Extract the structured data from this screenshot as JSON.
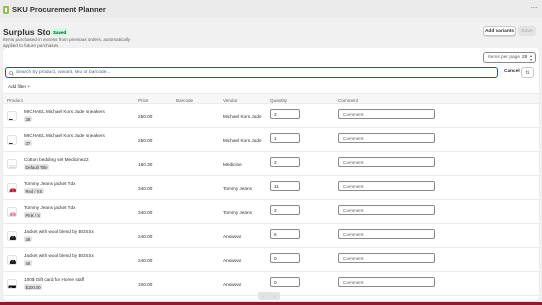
{
  "app": {
    "title": "SKU Procurement Planner",
    "more_icon": "more-horizontal-icon"
  },
  "page": {
    "title": "Surplus Stock",
    "badge": "Saved",
    "subtitle": "Items purchased in excess from previous orders, automatically applied to future purchases",
    "add_variants_label": "Add variants",
    "save_label": "Save"
  },
  "per_page": {
    "label": "Items per page",
    "value": "25"
  },
  "search": {
    "placeholder": "Search by product, variant, sku or barcode...",
    "cancel_label": "Cancel"
  },
  "filters": {
    "add_filter_label": "Add filter +"
  },
  "table": {
    "headers": {
      "product": "Product",
      "price": "Price",
      "barcode": "Barcode",
      "vendor": "Vendor",
      "quantity": "Quantity",
      "comment": "Comment"
    },
    "comment_placeholder": "Comment",
    "rows": [
      {
        "name": "MICHAEL Michael Kors Jude sneakers",
        "variant": "38",
        "price": "250.00",
        "vendor": "Michael Kors Jude",
        "quantity": "2",
        "thumb": "sneaker",
        "color": "#2b2b2b"
      },
      {
        "name": "MICHAEL Michael Kors Jude sneakers",
        "variant": "37",
        "price": "250.00",
        "vendor": "Michael Kors Jude",
        "quantity": "1",
        "thumb": "sneaker",
        "color": "#2b2b2b"
      },
      {
        "name": "Cotton bedding set Medicine22",
        "variant": "Default Title",
        "price": "150.30",
        "vendor": "Medicine",
        "quantity": "2",
        "thumb": "bedding",
        "color": "#d6d6d6"
      },
      {
        "name": "Tommy Jeans jacket Tdx",
        "variant": "Red / XS",
        "price": "340.00",
        "vendor": "Tommy Jeans",
        "quantity": "11",
        "thumb": "jacket",
        "color": "#c8102e"
      },
      {
        "name": "Tommy Jeans jacket Tdx",
        "variant": "Pink / S",
        "price": "340.00",
        "vendor": "Tommy Jeans",
        "quantity": "2",
        "thumb": "jacket",
        "color": "#e88aa8"
      },
      {
        "name": "Jacket with wool blend by BOSSx",
        "variant": "38",
        "price": "240.00",
        "vendor": "Answear",
        "quantity": "6",
        "thumb": "coat",
        "color": "#1f1f1f"
      },
      {
        "name": "Jacket with wool blend by BOSSx",
        "variant": "40",
        "price": "240.00",
        "vendor": "Answear",
        "quantity": "0",
        "thumb": "coat",
        "color": "#1f1f1f"
      },
      {
        "name": "100$ Gift card for Home staff",
        "variant": "$100.00",
        "price": "100.00",
        "vendor": "Answear",
        "quantity": "0",
        "thumb": "giftcard",
        "color": "#111111"
      }
    ]
  },
  "pagination": {
    "prev_icon": "chevron-left-icon",
    "next_icon": "chevron-right-icon"
  },
  "colors": {
    "accent": "#005bd3",
    "saved_badge_bg": "#cdfee1",
    "saved_badge_text": "#0c5132"
  }
}
